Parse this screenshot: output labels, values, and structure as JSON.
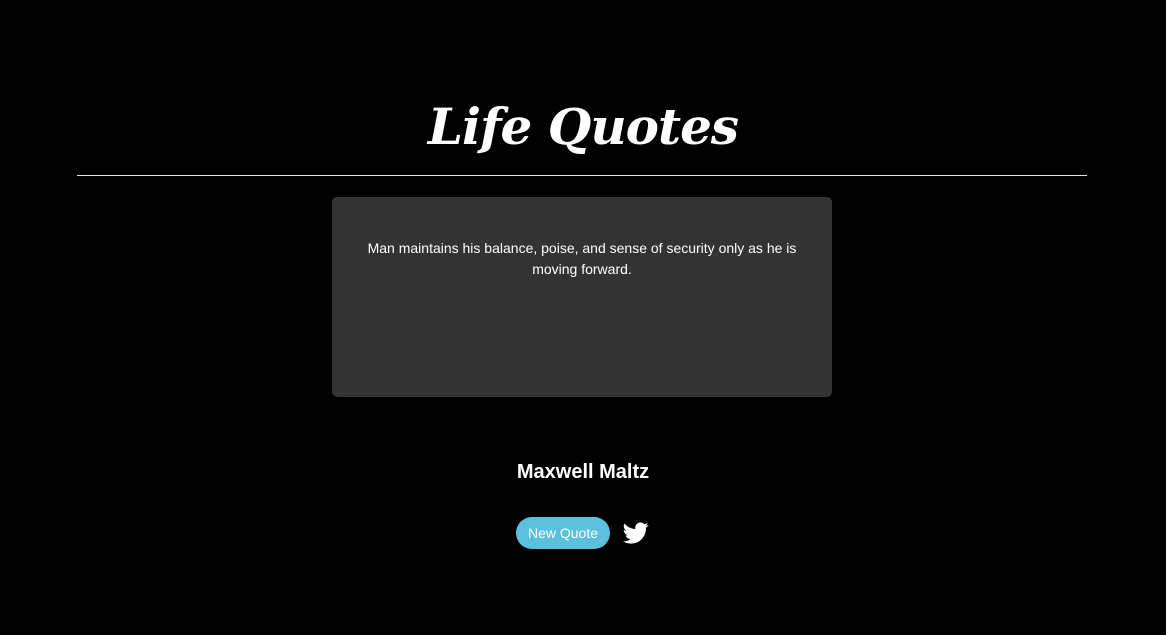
{
  "header": {
    "title": "Life Quotes"
  },
  "quote": {
    "text": "Man maintains his balance, poise, and sense of security only as he is moving forward.",
    "author": "Maxwell Maltz"
  },
  "actions": {
    "new_quote_label": "New Quote",
    "tweet_icon": "twitter-bird-icon"
  },
  "colors": {
    "background": "#000000",
    "card": "#333333",
    "button": "#5bc0de",
    "text": "#ffffff"
  }
}
